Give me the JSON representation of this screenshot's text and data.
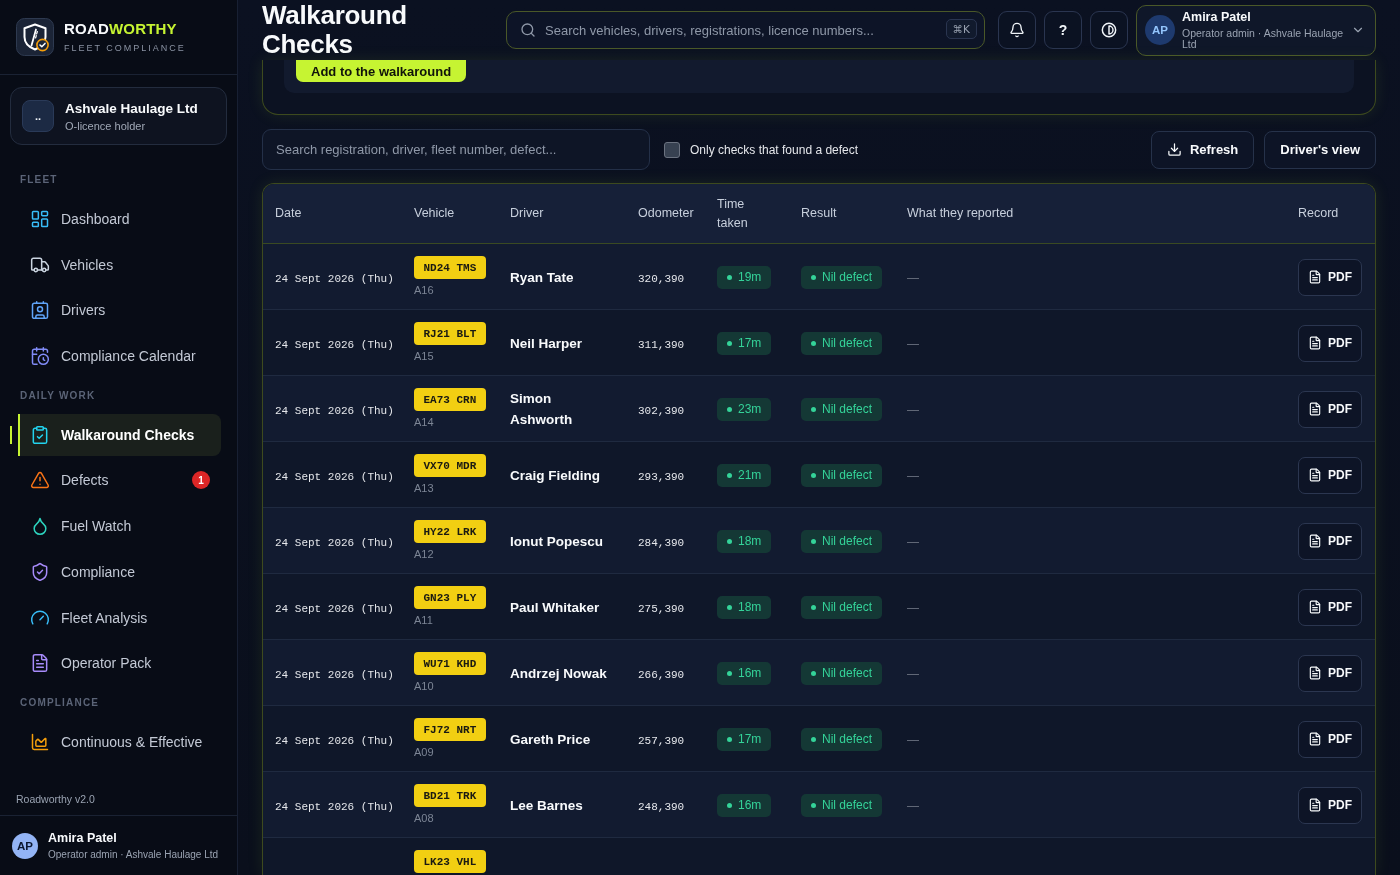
{
  "sidebar": {
    "brand": {
      "name_plain": "ROAD",
      "name_accent": "WORTHY",
      "tagline": "FLEET COMPLIANCE"
    },
    "organisation": {
      "initials": "..",
      "name": "Ashvale Haulage Ltd",
      "role": "O-licence holder"
    },
    "sections": [
      {
        "label": "FLEET",
        "items": [
          {
            "label": "Dashboard",
            "selected": false
          },
          {
            "label": "Vehicles",
            "selected": false
          },
          {
            "label": "Drivers",
            "selected": false
          },
          {
            "label": "Compliance Calendar",
            "selected": false
          }
        ]
      },
      {
        "label": "DAILY WORK",
        "items": [
          {
            "label": "Walkaround Checks",
            "selected": true
          },
          {
            "label": "Defects",
            "selected": false,
            "badge": "1"
          },
          {
            "label": "Fuel Watch",
            "selected": false
          },
          {
            "label": "Compliance",
            "selected": false
          },
          {
            "label": "Fleet Analysis",
            "selected": false
          },
          {
            "label": "Operator Pack",
            "selected": false
          }
        ]
      },
      {
        "label": "COMPLIANCE",
        "items": [
          {
            "label": "Continuous & Effective",
            "selected": false
          }
        ]
      }
    ],
    "version": "Roadworthy v2.0",
    "user": {
      "initials": "AP",
      "name": "Amira Patel",
      "role": "Operator admin · Ashvale Haulage Ltd"
    }
  },
  "header": {
    "title": "Walkaround Checks",
    "search": {
      "placeholder": "Search vehicles, drivers, registrations, licence numbers...",
      "shortcut": "⌘K"
    },
    "help_label": "?",
    "user": {
      "initials": "AP",
      "name": "Amira Patel",
      "role": "Operator admin · Ashvale Haulage Ltd"
    }
  },
  "add_card": {
    "button": "Add to the walkaround"
  },
  "filters": {
    "search": {
      "placeholder": "Search registration, driver, fleet number, defect..."
    },
    "defects_only": {
      "label": "Only checks that found a defect",
      "checked": false
    },
    "buttons": [
      {
        "label": "Refresh",
        "kind": "download"
      },
      {
        "label": "Driver's view",
        "kind": "plain"
      }
    ]
  },
  "table": {
    "columns": [
      "Date",
      "Vehicle",
      "Driver",
      "Odometer",
      "Time taken",
      "Result",
      "What they reported",
      "Record"
    ],
    "rows": [
      {
        "date": "24 Sept 2026 (Thu)",
        "plate": "ND24 TMS",
        "fleet_number": "A16",
        "driver": "Ryan Tate",
        "odometer": "320,390",
        "time_taken": "19m",
        "result": "Nil defect",
        "reported": "—",
        "record": "PDF"
      },
      {
        "date": "24 Sept 2026 (Thu)",
        "plate": "RJ21 BLT",
        "fleet_number": "A15",
        "driver": "Neil Harper",
        "odometer": "311,390",
        "time_taken": "17m",
        "result": "Nil defect",
        "reported": "—",
        "record": "PDF"
      },
      {
        "date": "24 Sept 2026 (Thu)",
        "plate": "EA73 CRN",
        "fleet_number": "A14",
        "driver": "Simon Ashworth",
        "odometer": "302,390",
        "time_taken": "23m",
        "result": "Nil defect",
        "reported": "—",
        "record": "PDF"
      },
      {
        "date": "24 Sept 2026 (Thu)",
        "plate": "VX70 MDR",
        "fleet_number": "A13",
        "driver": "Craig Fielding",
        "odometer": "293,390",
        "time_taken": "21m",
        "result": "Nil defect",
        "reported": "—",
        "record": "PDF"
      },
      {
        "date": "24 Sept 2026 (Thu)",
        "plate": "HY22 LRK",
        "fleet_number": "A12",
        "driver": "Ionut Popescu",
        "odometer": "284,390",
        "time_taken": "18m",
        "result": "Nil defect",
        "reported": "—",
        "record": "PDF"
      },
      {
        "date": "24 Sept 2026 (Thu)",
        "plate": "GN23 PLY",
        "fleet_number": "A11",
        "driver": "Paul Whitaker",
        "odometer": "275,390",
        "time_taken": "18m",
        "result": "Nil defect",
        "reported": "—",
        "record": "PDF"
      },
      {
        "date": "24 Sept 2026 (Thu)",
        "plate": "WU71 KHD",
        "fleet_number": "A10",
        "driver": "Andrzej Nowak",
        "odometer": "266,390",
        "time_taken": "16m",
        "result": "Nil defect",
        "reported": "—",
        "record": "PDF"
      },
      {
        "date": "24 Sept 2026 (Thu)",
        "plate": "FJ72 NRT",
        "fleet_number": "A09",
        "driver": "Gareth Price",
        "odometer": "257,390",
        "time_taken": "17m",
        "result": "Nil defect",
        "reported": "—",
        "record": "PDF"
      },
      {
        "date": "24 Sept 2026 (Thu)",
        "plate": "BD21 TRK",
        "fleet_number": "A08",
        "driver": "Lee Barnes",
        "odometer": "248,390",
        "time_taken": "16m",
        "result": "Nil defect",
        "reported": "—",
        "record": "PDF"
      },
      {
        "plate": "LK23 VHL"
      }
    ]
  }
}
